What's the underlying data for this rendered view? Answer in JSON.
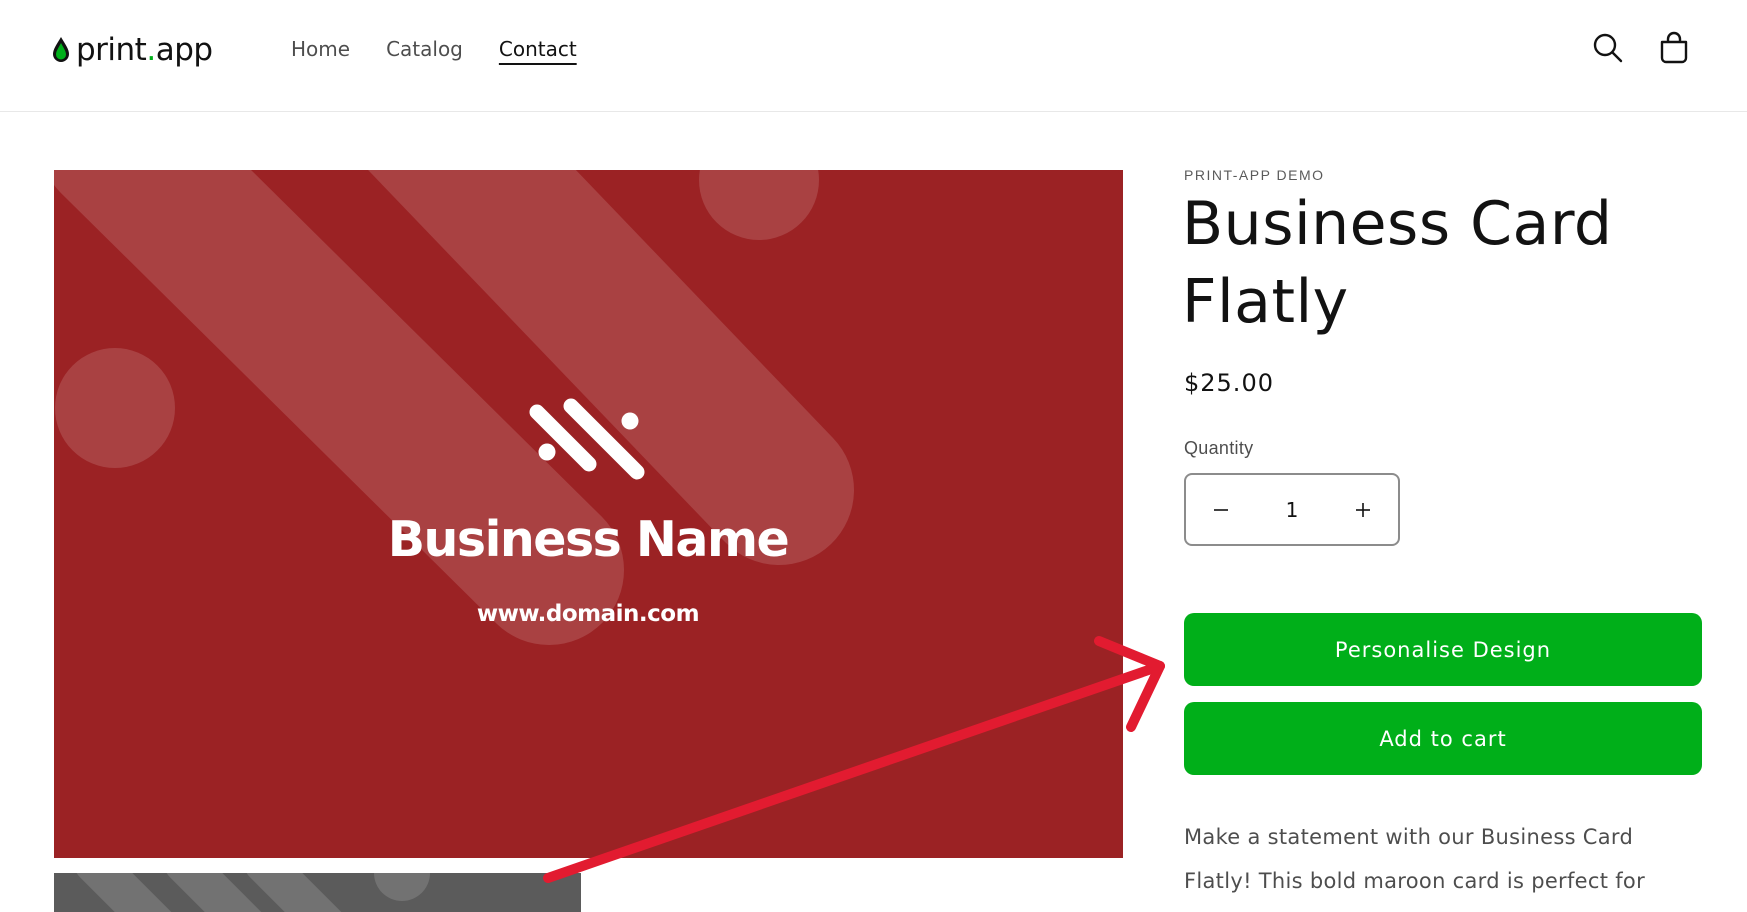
{
  "header": {
    "logo": {
      "text_main": "print",
      "text_dot": ".",
      "text_end": "app"
    },
    "nav": [
      "Home",
      "Catalog",
      "Contact"
    ],
    "active_nav": "Contact",
    "icons": {
      "search": "search-icon",
      "cart": "cart-icon"
    }
  },
  "media": {
    "business_name": "Business Name",
    "domain": "www.domain.com"
  },
  "product": {
    "vendor": "PRINT-APP DEMO",
    "title": "Business Card Flatly",
    "price": "$25.00",
    "quantity_label": "Quantity",
    "quantity_value": "1",
    "personalise_label": "Personalise Design",
    "add_to_cart_label": "Add to cart",
    "description": "Make a statement with our Business Card Flatly! This bold maroon card is perfect for"
  },
  "colors": {
    "accent_green": "#00af19",
    "card_maroon": "#9b2224",
    "annotation_arrow": "#e21b30"
  }
}
